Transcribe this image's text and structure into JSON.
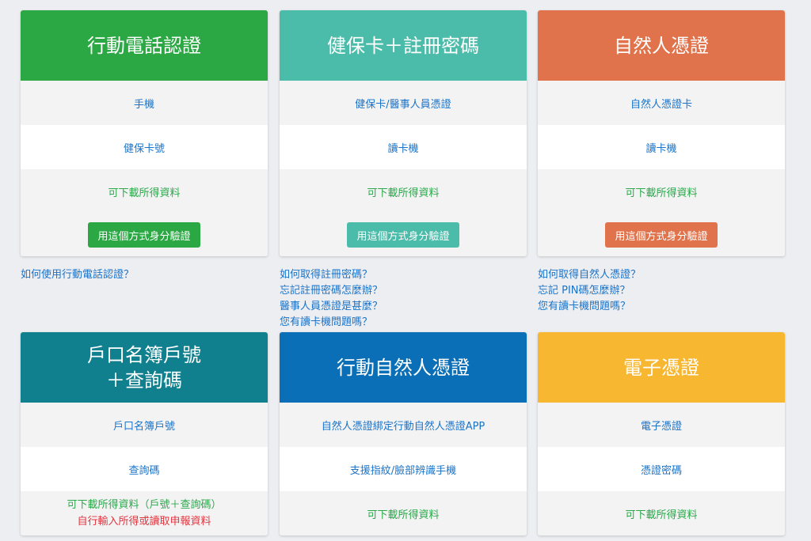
{
  "colors": {
    "green": "#2ba844",
    "teal": "#4cbcaa",
    "orange": "#e0734b",
    "dark_teal": "#11808e",
    "blue": "#0a6fb6",
    "yellow": "#f7b731",
    "link": "#1a73c8",
    "accent_text": "#2aa84a",
    "warning_text": "#e0353f"
  },
  "cards": [
    {
      "title": "行動電話認證",
      "rows": [
        "手機",
        "健保卡號",
        "可下載所得資料"
      ],
      "button": "用這個方式身分驗證",
      "links": [
        "如何使用行動電話認證？"
      ]
    },
    {
      "title": "健保卡＋註冊密碼",
      "rows": [
        "健保卡/醫事人員憑證",
        "讀卡機",
        "可下載所得資料"
      ],
      "button": "用這個方式身分驗證",
      "links": [
        "如何取得註冊密碼？",
        "忘記註冊密碼怎麼辦？",
        "醫事人員憑證是甚麼？",
        "您有讀卡機問題嗎？"
      ]
    },
    {
      "title": "自然人憑證",
      "rows": [
        "自然人憑證卡",
        "讀卡機",
        "可下載所得資料"
      ],
      "button": "用這個方式身分驗證",
      "links": [
        "如何取得自然人憑證？",
        "忘記 PIN碼怎麼辦？",
        "您有讀卡機問題嗎？"
      ]
    },
    {
      "title_line1": "戶口名簿戶號",
      "title_line2": "＋查詢碼",
      "rows": [
        "戶口名簿戶號",
        "查詢碼",
        "可下載所得資料（戶號＋查詢碼）"
      ],
      "note": "自行輸入所得或讀取申報資料"
    },
    {
      "title": "行動自然人憑證",
      "rows": [
        "自然人憑證綁定行動自然人憑證APP",
        "支援指紋/臉部辨識手機",
        "可下載所得資料"
      ]
    },
    {
      "title": "電子憑證",
      "rows": [
        "電子憑證",
        "憑證密碼",
        "可下載所得資料"
      ]
    }
  ]
}
